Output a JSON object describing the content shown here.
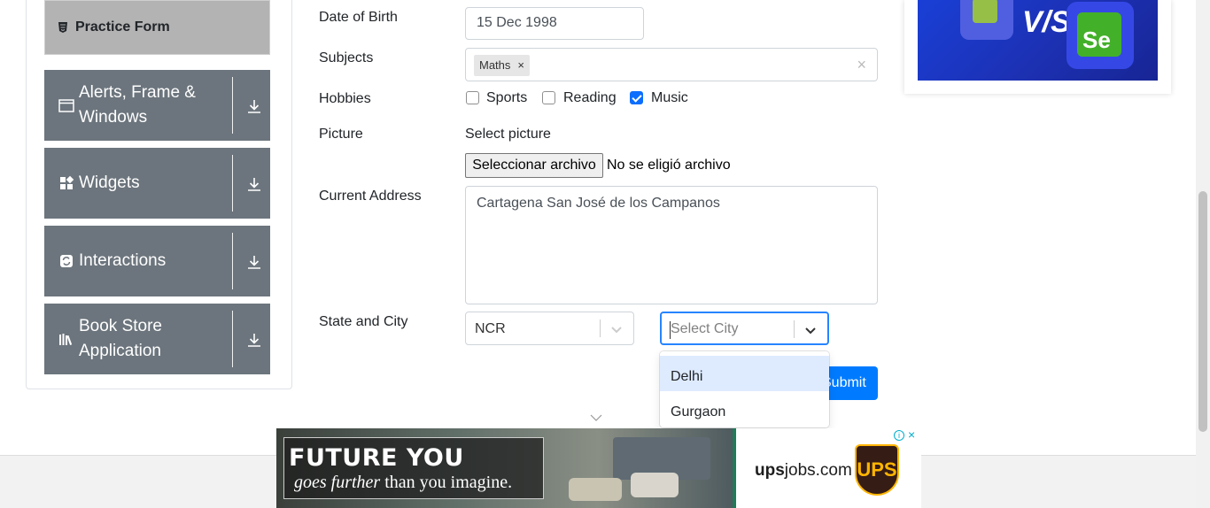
{
  "sidebar": {
    "active_item": "Practice Form",
    "groups": [
      {
        "label": "Alerts, Frame & Windows",
        "icon": "window-icon"
      },
      {
        "label": "Widgets",
        "icon": "widgets-icon"
      },
      {
        "label": "Interactions",
        "icon": "interactions-icon"
      },
      {
        "label": "Book Store Application",
        "icon": "books-icon"
      }
    ]
  },
  "form": {
    "dob_label": "Date of Birth",
    "dob_value": "15 Dec 1998",
    "subjects_label": "Subjects",
    "subjects_chips": [
      "Maths"
    ],
    "chip_remove": "×",
    "subjects_clear": "×",
    "hobbies_label": "Hobbies",
    "hobbies": [
      {
        "label": "Sports",
        "checked": false
      },
      {
        "label": "Reading",
        "checked": false
      },
      {
        "label": "Music",
        "checked": true
      }
    ],
    "picture_label": "Picture",
    "picture_hint": "Select picture",
    "file_button": "Seleccionar archivo",
    "file_status": "No se eligió archivo",
    "address_label": "Current Address",
    "address_value": "Cartagena San José de los Campanos",
    "state_city_label": "State and City",
    "state_value": "NCR",
    "city_placeholder": "Select City",
    "city_options": [
      "Delhi",
      "Gurgaon"
    ],
    "submit_label": "Submit"
  },
  "bottom_ad": {
    "headline": "FUTURE YOU",
    "tagline_italic": "goes further",
    "tagline_rest": " than you imagine.",
    "url_bold": "ups",
    "url_rest": "jobs.com",
    "brand": "UPS",
    "info": "i",
    "close": "×"
  },
  "right_ad": {
    "vs_text": "V/S",
    "se_text": "Se"
  },
  "colors": {
    "sidebar_group": "#6c757d",
    "active_item": "#b3b3b3",
    "primary": "#007bff",
    "focus": "#2684ff",
    "option_highlight": "#deebff"
  }
}
